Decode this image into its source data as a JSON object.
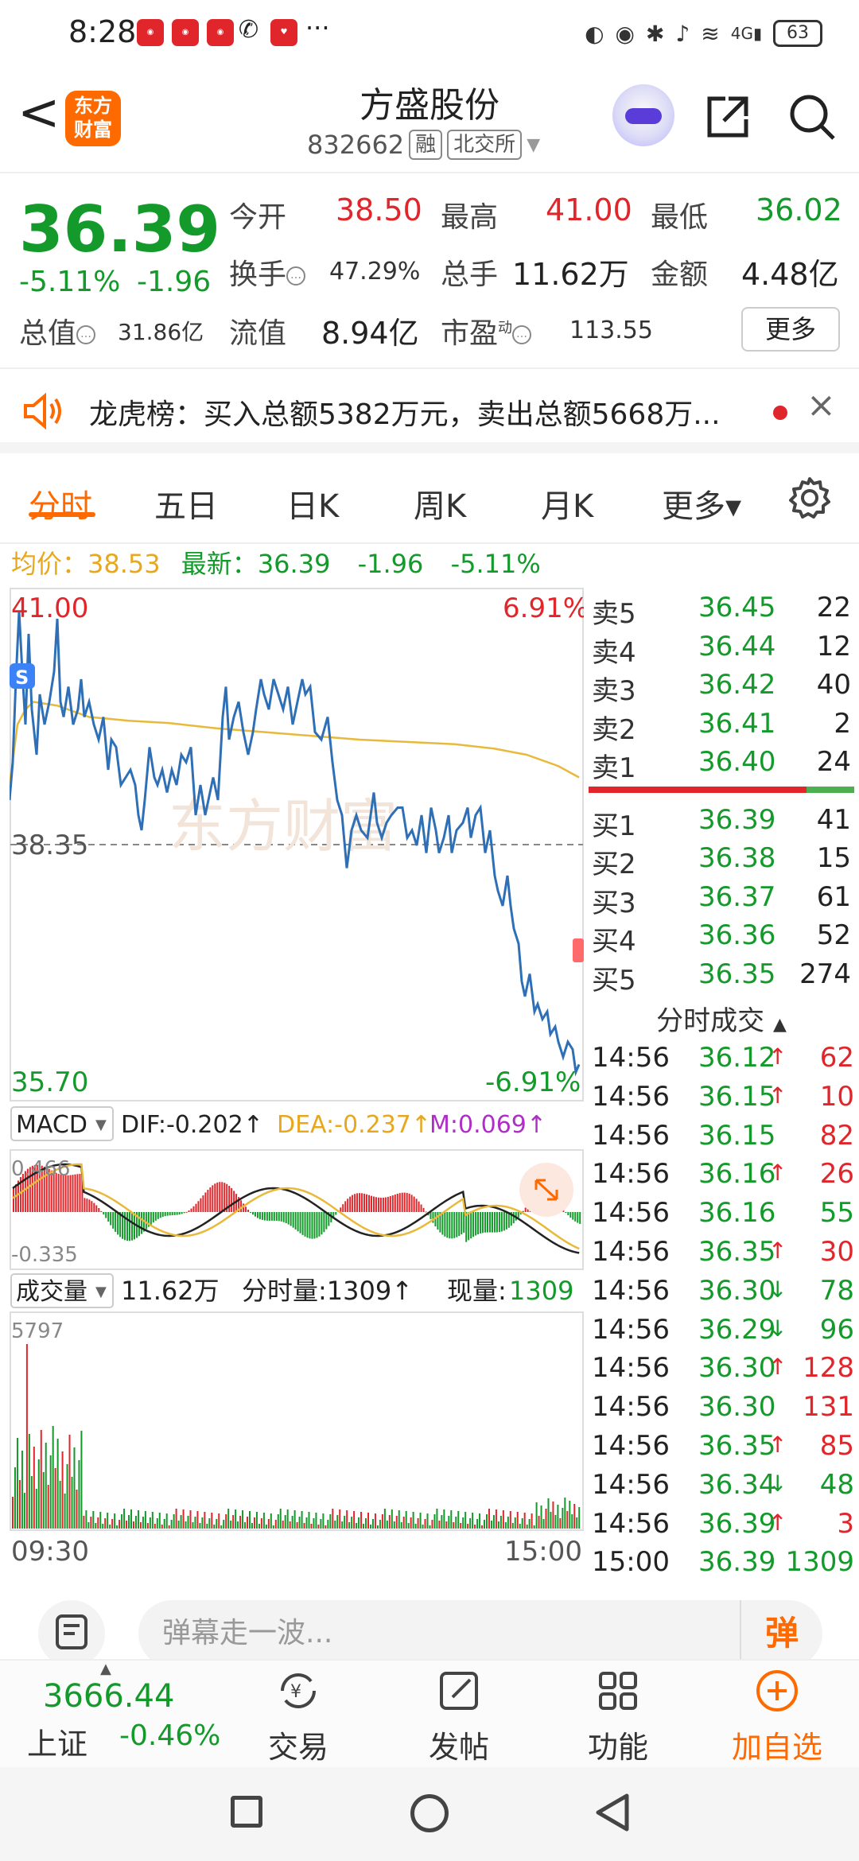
{
  "status_bar": {
    "time": "8:28",
    "dots": "···",
    "network": "4G",
    "battery": "63"
  },
  "header": {
    "back": "<",
    "logo_line1": "东方",
    "logo_line2": "财富",
    "stock_name": "方盛股份",
    "stock_code": "832662",
    "tag_margin": "融",
    "tag_exchange": "北交所"
  },
  "quote": {
    "price": "36.39",
    "change_pct": "-5.11%",
    "change_amt": "-1.96",
    "open_label": "今开",
    "open": "38.50",
    "high_label": "最高",
    "high": "41.00",
    "low_label": "最低",
    "low": "36.02",
    "turnover_label": "换手",
    "turnover": "47.29%",
    "volume_label": "总手",
    "volume": "11.62万",
    "amount_label": "金额",
    "amount": "4.48亿",
    "total_mv_label": "总值",
    "total_mv": "31.86亿",
    "float_mv_label": "流值",
    "float_mv": "8.94亿",
    "pe_label": "市盈",
    "pe_sup": "动",
    "pe": "113.55",
    "more": "更多"
  },
  "banner": {
    "text": "龙虎榜：买入总额5382万元，卖出总额5668万..."
  },
  "tabs": [
    "分时",
    "五日",
    "日K",
    "周K",
    "月K",
    "更多▾"
  ],
  "avg_row": {
    "avg_label": "均价：",
    "avg": "38.53",
    "latest_label": "最新：",
    "latest": "36.39",
    "chg": "-1.96",
    "pct": "-5.11%"
  },
  "intraday": {
    "max_label": "41.00",
    "min_label": "35.70",
    "ref_label": "38.35",
    "max_pct": "6.91%",
    "min_pct": "-6.91%",
    "s_marker": "S",
    "start_time": "09:30",
    "end_time": "15:00"
  },
  "macd": {
    "name": "MACD",
    "dif": "DIF:-0.202↑",
    "dea": "DEA:-0.237↑",
    "m": "M:0.069↑",
    "max": "0.466",
    "min": "-0.335"
  },
  "volume_panel": {
    "name": "成交量",
    "total": "11.62万",
    "minute_label": "分时量:1309↑",
    "current_label": "现量:",
    "current": "1309",
    "max": "5797"
  },
  "order_book": {
    "asks": [
      {
        "label": "卖5",
        "price": "36.45",
        "vol": "22"
      },
      {
        "label": "卖4",
        "price": "36.44",
        "vol": "12"
      },
      {
        "label": "卖3",
        "price": "36.42",
        "vol": "40"
      },
      {
        "label": "卖2",
        "price": "36.41",
        "vol": "2"
      },
      {
        "label": "卖1",
        "price": "36.40",
        "vol": "24"
      }
    ],
    "bids": [
      {
        "label": "买1",
        "price": "36.39",
        "vol": "41"
      },
      {
        "label": "买2",
        "price": "36.38",
        "vol": "15"
      },
      {
        "label": "买3",
        "price": "36.37",
        "vol": "61"
      },
      {
        "label": "买4",
        "price": "36.36",
        "vol": "52"
      },
      {
        "label": "买5",
        "price": "36.35",
        "vol": "274"
      }
    ]
  },
  "trades_title": "分时成交",
  "trades": [
    {
      "time": "14:56",
      "price": "36.12",
      "arrow": "↑",
      "vol": "62",
      "dir": "up"
    },
    {
      "time": "14:56",
      "price": "36.15",
      "arrow": "↑",
      "vol": "10",
      "dir": "up"
    },
    {
      "time": "14:56",
      "price": "36.15",
      "arrow": "",
      "vol": "82",
      "dir": "up"
    },
    {
      "time": "14:56",
      "price": "36.16",
      "arrow": "↑",
      "vol": "26",
      "dir": "up"
    },
    {
      "time": "14:56",
      "price": "36.16",
      "arrow": "",
      "vol": "55",
      "dir": "down"
    },
    {
      "time": "14:56",
      "price": "36.35",
      "arrow": "↑",
      "vol": "30",
      "dir": "up"
    },
    {
      "time": "14:56",
      "price": "36.30",
      "arrow": "↓",
      "vol": "78",
      "dir": "down"
    },
    {
      "time": "14:56",
      "price": "36.29",
      "arrow": "↓",
      "vol": "96",
      "dir": "down"
    },
    {
      "time": "14:56",
      "price": "36.30",
      "arrow": "↑",
      "vol": "128",
      "dir": "up"
    },
    {
      "time": "14:56",
      "price": "36.30",
      "arrow": "",
      "vol": "131",
      "dir": "up"
    },
    {
      "time": "14:56",
      "price": "36.35",
      "arrow": "↑",
      "vol": "85",
      "dir": "up"
    },
    {
      "time": "14:56",
      "price": "36.34",
      "arrow": "↓",
      "vol": "48",
      "dir": "down"
    },
    {
      "time": "14:56",
      "price": "36.39",
      "arrow": "↑",
      "vol": "3",
      "dir": "up"
    },
    {
      "time": "15:00",
      "price": "36.39",
      "arrow": "",
      "vol": "1309",
      "dir": "neutral"
    }
  ],
  "comment": {
    "placeholder": "弹幕走一波...",
    "danmu": "弹"
  },
  "bottom_bar": {
    "index_value": "3666.44",
    "index_name": "上证",
    "index_change": "-0.46%",
    "trade": "交易",
    "post": "发帖",
    "function": "功能",
    "watchlist": "加自选"
  },
  "colors": {
    "up": "#e0262b",
    "down": "#139a2b",
    "accent": "#ff6a00",
    "price_line": "#2f6fb5",
    "avg_line": "#e8b93a"
  }
}
